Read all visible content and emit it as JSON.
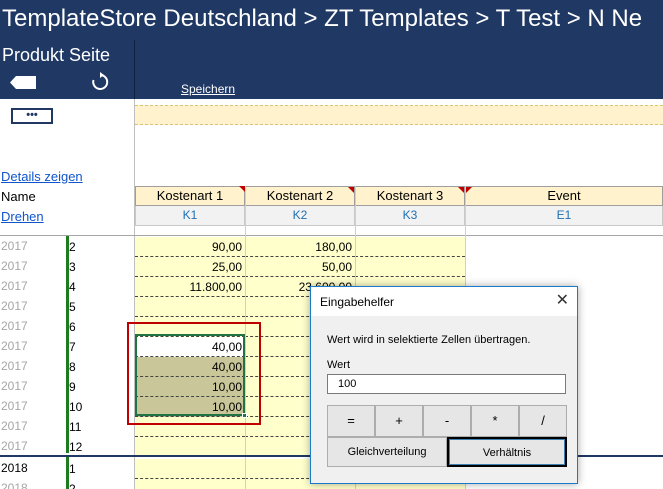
{
  "header": {
    "breadcrumb": "TemplateStore Deutschland > ZT  Templates > T  Test > N  Ne",
    "page_title": "Produkt Seite",
    "save_label": "Speichern"
  },
  "left": {
    "more_label": "•••",
    "details_link": "Details zeigen",
    "name_label": "Name",
    "rotate_link": "Drehen"
  },
  "columns": [
    {
      "name": "Kostenart 1",
      "code": "K1"
    },
    {
      "name": "Kostenart 2",
      "code": "K2"
    },
    {
      "name": "Kostenart 3",
      "code": "K3"
    },
    {
      "name": "Event",
      "code": "E1"
    }
  ],
  "rows": [
    {
      "year": "2017",
      "month": "2",
      "k1": "90,00",
      "k2": "180,00"
    },
    {
      "year": "2017",
      "month": "3",
      "k1": "25,00",
      "k2": "50,00"
    },
    {
      "year": "2017",
      "month": "4",
      "k1": "11.800,00",
      "k2": "23.600,00"
    },
    {
      "year": "2017",
      "month": "5",
      "k1": "",
      "k2": ""
    },
    {
      "year": "2017",
      "month": "6",
      "k1": "",
      "k2": ""
    },
    {
      "year": "2017",
      "month": "7",
      "k1": "40,00",
      "k2": ""
    },
    {
      "year": "2017",
      "month": "8",
      "k1": "40,00",
      "k2": ""
    },
    {
      "year": "2017",
      "month": "9",
      "k1": "10,00",
      "k2": ""
    },
    {
      "year": "2017",
      "month": "10",
      "k1": "10,00",
      "k2": ""
    },
    {
      "year": "2017",
      "month": "11",
      "k1": "",
      "k2": ""
    },
    {
      "year": "2017",
      "month": "12",
      "k1": "",
      "k2": ""
    },
    {
      "year": "2018",
      "month": "1",
      "k1": "",
      "k2": ""
    },
    {
      "year": "2018",
      "month": "2",
      "k1": "",
      "k2": ""
    }
  ],
  "dialog": {
    "title": "Eingabehelfer",
    "close": "✕",
    "message": "Wert wird in selektierte Zellen übertragen.",
    "value_label": "Wert",
    "value": "100",
    "operators": [
      "=",
      "+",
      "-",
      "*",
      "/"
    ],
    "distribute_label": "Gleichverteilung",
    "ratio_label": "Verhältnis"
  },
  "colors": {
    "header_bg": "#1f3864",
    "cell_yellow": "#ffffcc",
    "selection_green": "#217346",
    "highlight_red": "#c00000"
  }
}
